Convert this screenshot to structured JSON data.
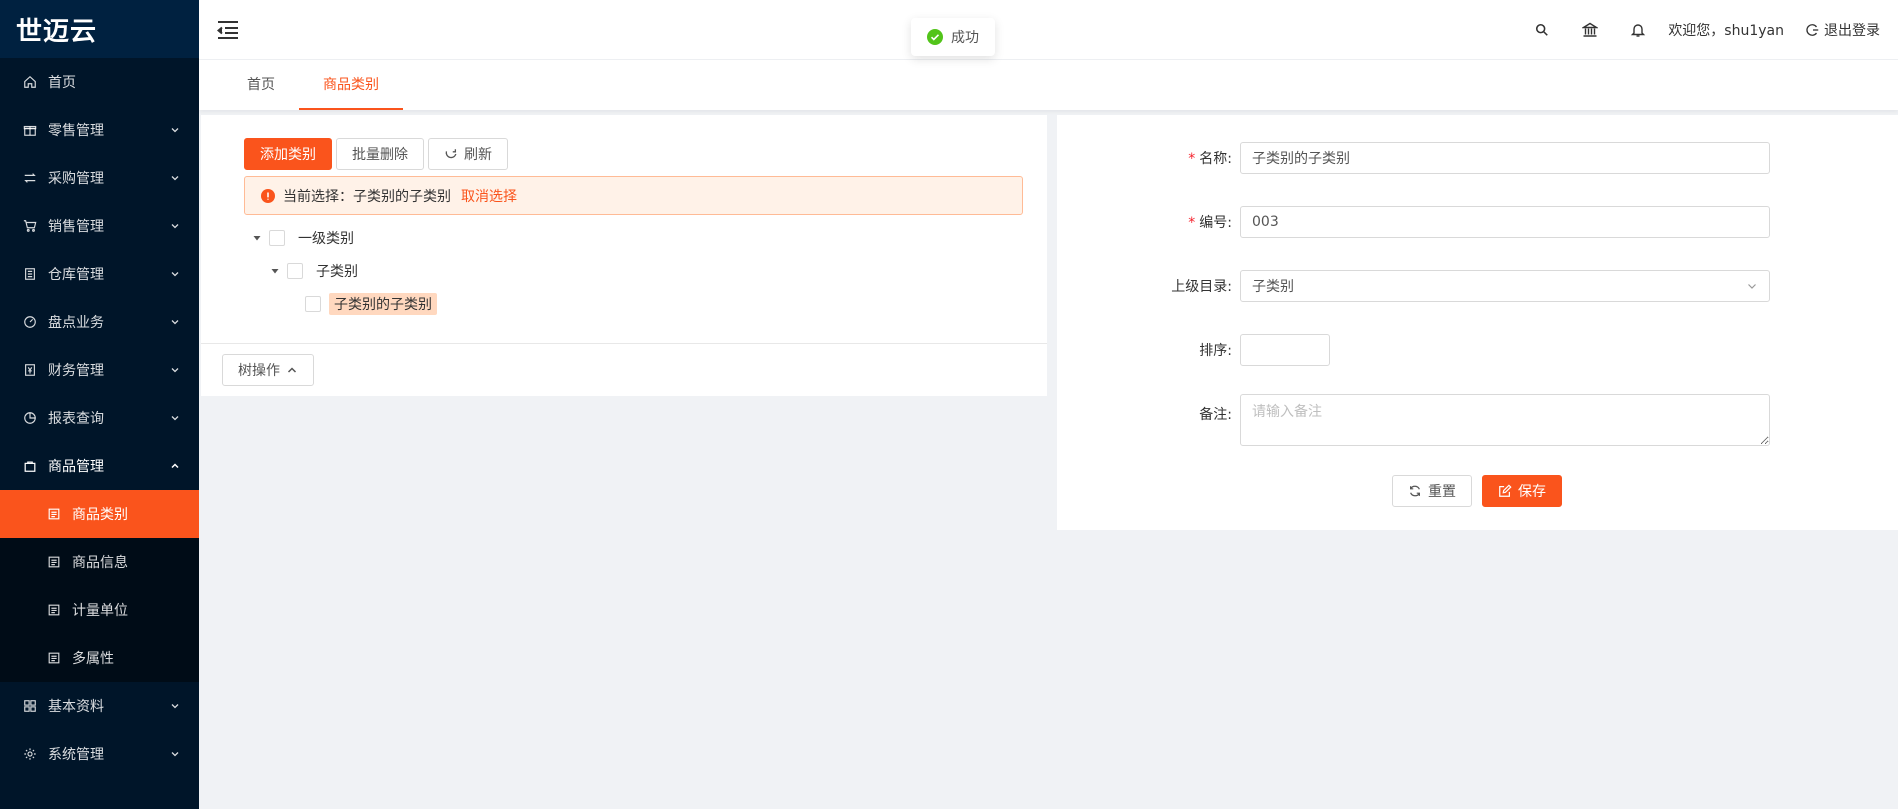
{
  "app": {
    "logo": "世迈云"
  },
  "sidebar": {
    "items": [
      {
        "label": "首页",
        "icon": "home-icon"
      },
      {
        "label": "零售管理",
        "icon": "gift-icon"
      },
      {
        "label": "采购管理",
        "icon": "swap-icon"
      },
      {
        "label": "销售管理",
        "icon": "cart-icon"
      },
      {
        "label": "仓库管理",
        "icon": "warehouse-icon"
      },
      {
        "label": "盘点业务",
        "icon": "dashboard-icon"
      },
      {
        "label": "财务管理",
        "icon": "finance-icon"
      },
      {
        "label": "报表查询",
        "icon": "pie-chart-icon"
      },
      {
        "label": "商品管理",
        "icon": "shopping-bag-icon"
      },
      {
        "label": "基本资料",
        "icon": "appstore-icon"
      },
      {
        "label": "系统管理",
        "icon": "setting-icon"
      }
    ],
    "product_submenu": [
      {
        "label": "商品类别"
      },
      {
        "label": "商品信息"
      },
      {
        "label": "计量单位"
      },
      {
        "label": "多属性"
      }
    ]
  },
  "header": {
    "welcome": "欢迎您，shu1yan",
    "logout": "退出登录"
  },
  "toast": {
    "text": "成功"
  },
  "tabs": [
    {
      "label": "首页"
    },
    {
      "label": "商品类别"
    }
  ],
  "toolbar": {
    "add": "添加类别",
    "batch_delete": "批量删除",
    "refresh": "刷新"
  },
  "alert": {
    "text": "当前选择：子类别的子类别",
    "cancel": "取消选择"
  },
  "tree": {
    "nodes": [
      {
        "label": "一级类别"
      },
      {
        "label": "子类别"
      },
      {
        "label": "子类别的子类别"
      }
    ],
    "operation": "树操作"
  },
  "form": {
    "name_label": "名称:",
    "name_value": "子类别的子类别",
    "code_label": "编号:",
    "code_value": "003",
    "parent_label": "上级目录:",
    "parent_value": "子类别",
    "sort_label": "排序:",
    "sort_value": "",
    "remark_label": "备注:",
    "remark_placeholder": "请输入备注",
    "reset": "重置",
    "save": "保存"
  },
  "colors": {
    "primary": "#fa541c",
    "sidebar_bg": "#001529",
    "success": "#52c41a"
  }
}
